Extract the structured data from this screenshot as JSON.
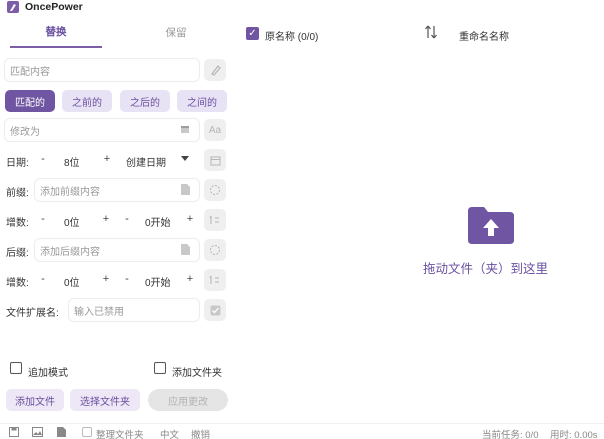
{
  "app": {
    "title": "OncePower"
  },
  "tabs": [
    {
      "label": "替换"
    },
    {
      "label": "保留"
    }
  ],
  "match": {
    "placeholder": "匹配内容"
  },
  "match_modes": [
    "匹配的",
    "之前的",
    "之后的",
    "之间的"
  ],
  "modify": {
    "placeholder": "修改为",
    "case_icon": "Aa"
  },
  "date": {
    "label": "日期:",
    "digits": "8位",
    "type": "创建日期",
    "minus": "-",
    "plus": "+"
  },
  "prefix": {
    "label": "前缀:",
    "placeholder": "添加前缀内容"
  },
  "increment1": {
    "label": "增数:",
    "digits": "0位",
    "start": "0开始",
    "minus": "-",
    "plus": "+"
  },
  "suffix": {
    "label": "后缀:",
    "placeholder": "添加后缀内容"
  },
  "increment2": {
    "label": "增数:",
    "digits": "0位",
    "start": "0开始",
    "minus": "-",
    "plus": "+"
  },
  "extension": {
    "label": "文件扩展名:",
    "placeholder": "输入已禁用"
  },
  "options": {
    "append_mode": "追加模式",
    "add_folder": "添加文件夹"
  },
  "buttons": {
    "add_file": "添加文件",
    "pick_folder": "选择文件夹",
    "apply": "应用更改"
  },
  "list_header": {
    "original": "原名称 (0/0)",
    "renamed": "重命名名称"
  },
  "drop_zone": {
    "text": "拖动文件（夹）到这里"
  },
  "status": {
    "organize": "整理文件夹",
    "language": "中文",
    "undo": "撤销",
    "tasks": "当前任务: 0/0",
    "time": "用时: 0.00s"
  },
  "colors": {
    "accent": "#6f55a2",
    "accent_light": "#e8e2f5"
  }
}
